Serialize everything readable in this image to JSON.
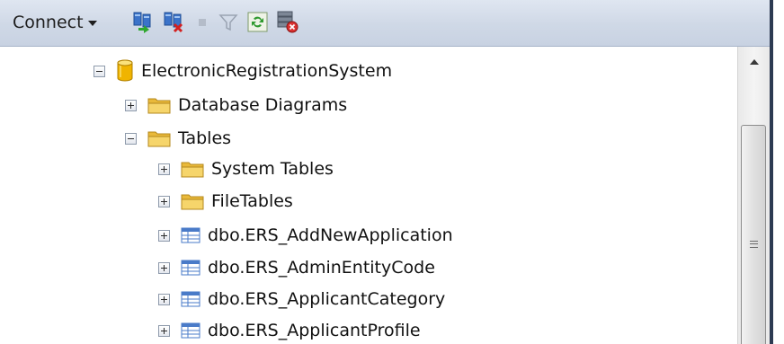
{
  "toolbar": {
    "connect_label": "Connect",
    "icons": [
      "connect-object-explorer-icon",
      "disconnect-icon",
      "stop-icon",
      "filter-icon",
      "refresh-icon",
      "disconnect-all-icon"
    ]
  },
  "tree": {
    "nodes": [
      {
        "label": "ElectronicRegistrationSystem",
        "icon": "database-icon",
        "expanded": true,
        "level": 0
      },
      {
        "label": "Database Diagrams",
        "icon": "folder-icon",
        "expanded": false,
        "level": 1
      },
      {
        "label": "Tables",
        "icon": "folder-icon",
        "expanded": true,
        "level": 1
      },
      {
        "label": "System Tables",
        "icon": "folder-icon",
        "expanded": false,
        "level": 2
      },
      {
        "label": "FileTables",
        "icon": "folder-icon",
        "expanded": false,
        "level": 2
      },
      {
        "label": "dbo.ERS_AddNewApplication",
        "icon": "table-icon",
        "expanded": false,
        "level": 2
      },
      {
        "label": "dbo.ERS_AdminEntityCode",
        "icon": "table-icon",
        "expanded": false,
        "level": 2
      },
      {
        "label": "dbo.ERS_ApplicantCategory",
        "icon": "table-icon",
        "expanded": false,
        "level": 2
      },
      {
        "label": "dbo.ERS_ApplicantProfile",
        "icon": "table-icon",
        "expanded": false,
        "level": 2
      }
    ]
  },
  "colors": {
    "toolbar_bg": "#d3dbe8",
    "folder": "#f2c94c",
    "database": "#f0b400",
    "table": "#4a7bc8"
  }
}
